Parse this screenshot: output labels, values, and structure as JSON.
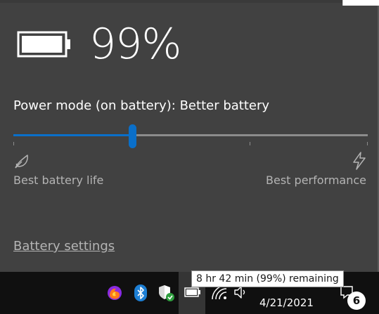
{
  "battery": {
    "percent_text": "99%",
    "charge_level": 0.99,
    "icon": "battery-icon"
  },
  "power_mode": {
    "label": "Power mode (on battery): Better battery",
    "slider_position": 0.335,
    "slider_ticks": [
      0.0,
      0.667,
      1.0
    ],
    "left_label": "Best battery life",
    "left_icon": "leaf-icon",
    "right_label": "Best performance",
    "right_icon": "lightning-bolt-icon"
  },
  "settings_link": "Battery settings",
  "tooltip": "8 hr 42 min (99%) remaining",
  "taskbar": {
    "tray_icons": [
      "firefox-icon",
      "bluetooth-icon",
      "windows-security-icon",
      "battery-icon",
      "wifi-icon",
      "volume-icon"
    ],
    "date": "4/21/2021",
    "notification_count": "6",
    "notification_icon": "action-center-icon"
  },
  "colors": {
    "flyout_background": "#414141",
    "accent": "#0a6fc9",
    "taskbar_background": "#101010",
    "secondary_text": "#b4b4b4"
  }
}
